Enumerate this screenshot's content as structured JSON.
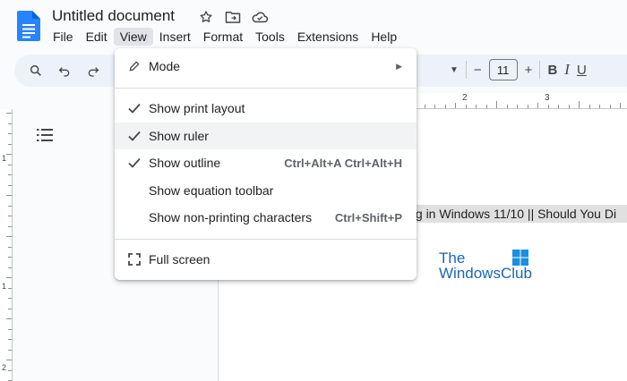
{
  "document": {
    "title": "Untitled document"
  },
  "menubar": [
    "File",
    "Edit",
    "View",
    "Insert",
    "Format",
    "Tools",
    "Extensions",
    "Help"
  ],
  "active_menu": "View",
  "toolbar": {
    "font_size": "11",
    "decrease": "−",
    "increase": "+",
    "bold": "B",
    "italic": "I",
    "underline": "U"
  },
  "ruler": {
    "h_numbers": [
      "2",
      "3"
    ],
    "v_numbers": [
      "1",
      "1",
      "2"
    ]
  },
  "view_menu": {
    "mode": {
      "label": "Mode"
    },
    "print_layout": {
      "label": "Show print layout",
      "checked": true
    },
    "ruler": {
      "label": "Show ruler",
      "checked": true
    },
    "outline": {
      "label": "Show outline",
      "checked": true,
      "shortcut": "Ctrl+Alt+A Ctrl+Alt+H"
    },
    "equation": {
      "label": "Show equation toolbar"
    },
    "nonprinting": {
      "label": "Show non-printing characters",
      "shortcut": "Ctrl+Shift+P"
    },
    "fullscreen": {
      "label": "Full screen"
    }
  },
  "page": {
    "text": "ing in Windows 11/10 || Should You Di",
    "logo_line1": "The",
    "logo_line2": "WindowsClub"
  },
  "colors": {
    "accent": "#1a73e8",
    "logo": "#1a66b4",
    "menu_active": "#e1e3e8"
  }
}
